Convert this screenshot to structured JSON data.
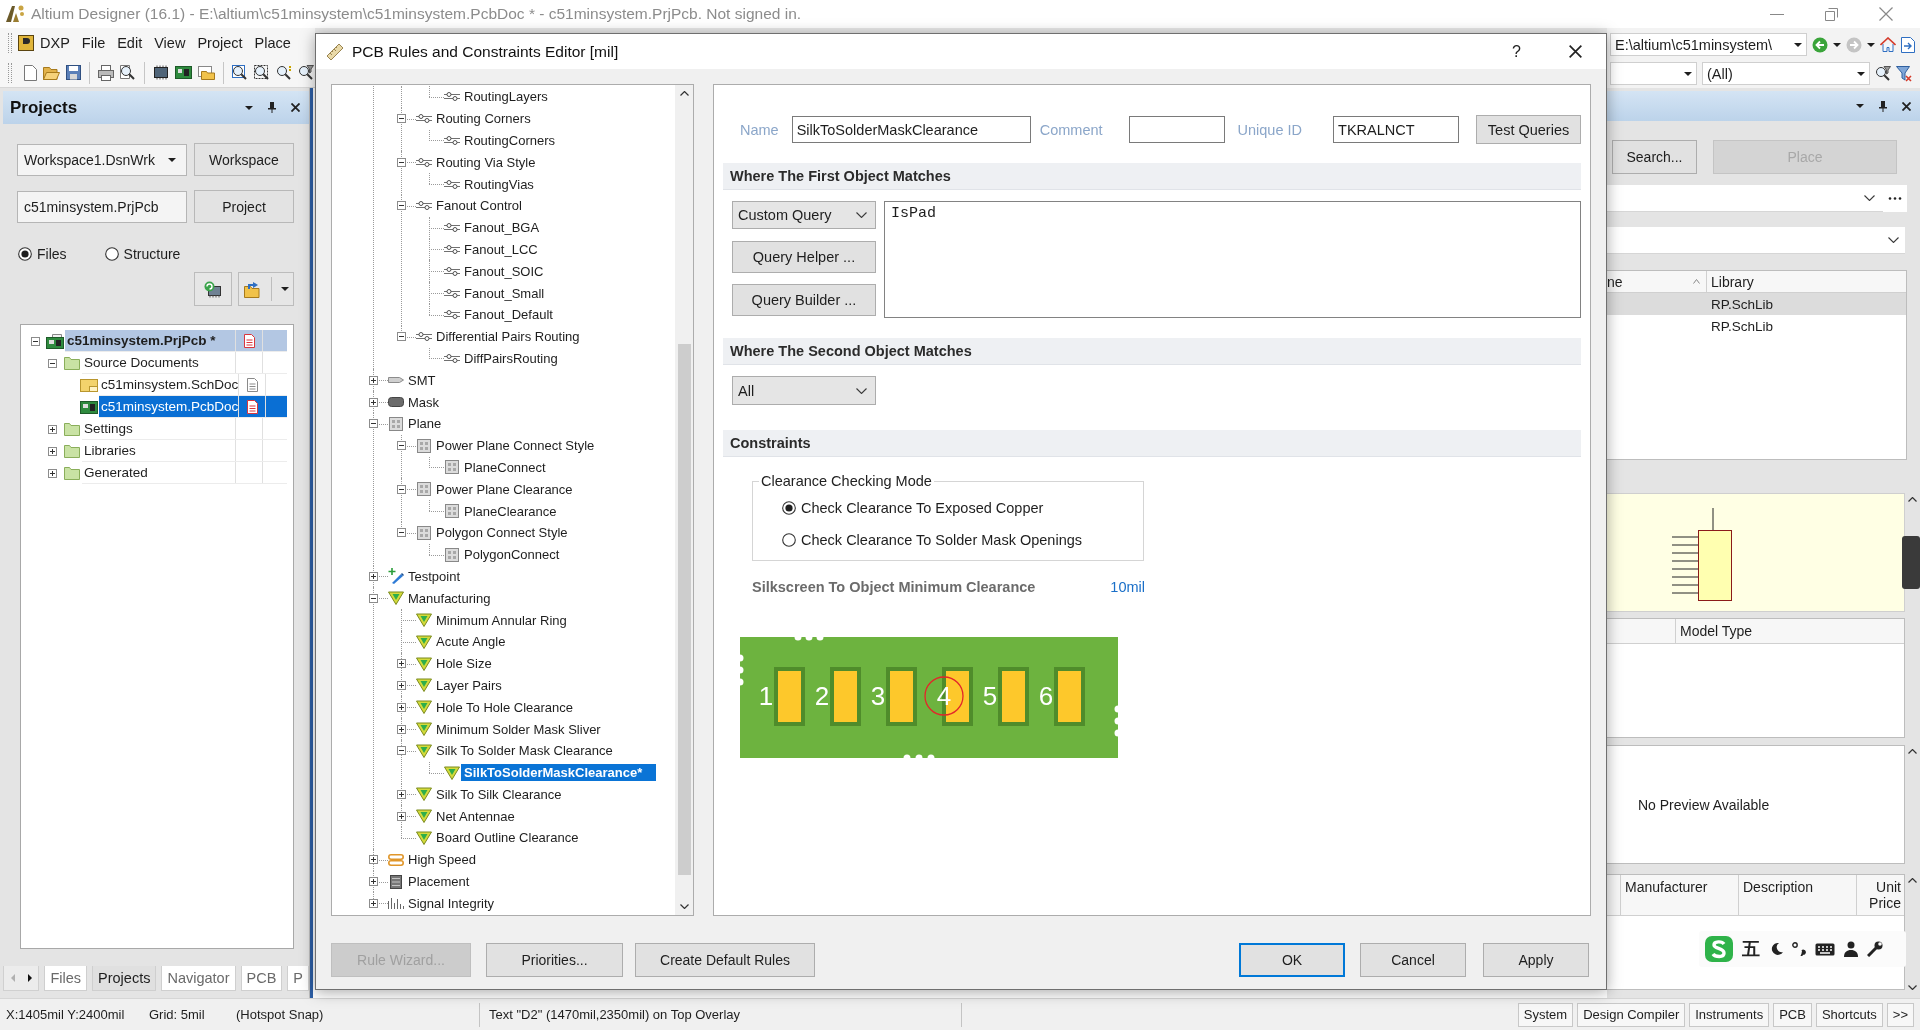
{
  "window": {
    "title": "Altium Designer (16.1) - E:\\altium\\c51minsystem\\c51minsystem.PcbDoc * - c51minsystem.PrjPcb. Not signed in."
  },
  "menu": [
    "DXP",
    "File",
    "Edit",
    "View",
    "Project",
    "Place"
  ],
  "navigation": {
    "path": "E:\\altium\\c51minsystem\\",
    "filter": "(All)"
  },
  "projects_panel": {
    "title": "Projects",
    "workspace": "Workspace1.DsnWrk",
    "workspace_button": "Workspace",
    "project": "c51minsystem.PrjPcb",
    "project_button": "Project",
    "view_options": [
      {
        "label": "Files",
        "selected": true
      },
      {
        "label": "Structure",
        "selected": false
      }
    ],
    "tree": [
      {
        "label": "c51minsystem.PrjPcb *",
        "kind": "project",
        "expanded": true,
        "active": true,
        "selected": false,
        "modified": true,
        "children": [
          {
            "label": "Source Documents",
            "kind": "folder",
            "expanded": true,
            "active": false,
            "selected": false,
            "children": [
              {
                "label": "c51minsystem.SchDoc",
                "kind": "schematic",
                "active": false,
                "selected": false,
                "modified": false
              },
              {
                "label": "c51minsystem.PcbDoc",
                "kind": "pcb",
                "active": false,
                "selected": true,
                "modified": true
              }
            ]
          },
          {
            "label": "Settings",
            "kind": "folder",
            "expanded": false,
            "active": false,
            "selected": false
          },
          {
            "label": "Libraries",
            "kind": "folder",
            "expanded": false,
            "active": false,
            "selected": false
          },
          {
            "label": "Generated",
            "kind": "folder",
            "expanded": false,
            "active": false,
            "selected": false
          }
        ]
      }
    ],
    "tabs": [
      {
        "label": "Files",
        "selected": false
      },
      {
        "label": "Projects",
        "selected": true
      },
      {
        "label": "Navigator",
        "selected": false
      },
      {
        "label": "PCB",
        "selected": false
      },
      {
        "label": "P",
        "selected": false
      }
    ]
  },
  "dialog": {
    "title": "PCB Rules and Constraints Editor [mil]",
    "help": "?",
    "rule_tree": [
      {
        "children": [
          {
            "children": [
              {
                "label": "RoutingLayers",
                "kind": "routing",
                "selected": false
              }
            ]
          },
          {
            "label": "Routing Corners",
            "kind": "routing",
            "expanded": true,
            "selected": false,
            "children": [
              {
                "label": "RoutingCorners",
                "kind": "routing",
                "selected": false
              }
            ]
          },
          {
            "label": "Routing Via Style",
            "kind": "routing",
            "expanded": true,
            "selected": false,
            "children": [
              {
                "label": "RoutingVias",
                "kind": "routing",
                "selected": false
              }
            ]
          },
          {
            "label": "Fanout Control",
            "kind": "routing",
            "expanded": true,
            "selected": false,
            "children": [
              {
                "label": "Fanout_BGA",
                "kind": "routing",
                "selected": false
              },
              {
                "label": "Fanout_LCC",
                "kind": "routing",
                "selected": false
              },
              {
                "label": "Fanout_SOIC",
                "kind": "routing",
                "selected": false
              },
              {
                "label": "Fanout_Small",
                "kind": "routing",
                "selected": false
              },
              {
                "label": "Fanout_Default",
                "kind": "routing",
                "selected": false
              }
            ]
          },
          {
            "label": "Differential Pairs Routing",
            "kind": "routing",
            "expanded": true,
            "selected": false,
            "children": [
              {
                "label": "DiffPairsRouting",
                "kind": "routing",
                "selected": false
              }
            ]
          }
        ]
      },
      {
        "label": "SMT",
        "kind": "smt",
        "expanded": false,
        "selected": false
      },
      {
        "label": "Mask",
        "kind": "mask",
        "expanded": false,
        "selected": false
      },
      {
        "label": "Plane",
        "kind": "plane",
        "expanded": true,
        "selected": false,
        "children": [
          {
            "label": "Power Plane Connect Style",
            "kind": "plane",
            "expanded": true,
            "selected": false,
            "children": [
              {
                "label": "PlaneConnect",
                "kind": "plane",
                "selected": false
              }
            ]
          },
          {
            "label": "Power Plane Clearance",
            "kind": "plane",
            "expanded": true,
            "selected": false,
            "children": [
              {
                "label": "PlaneClearance",
                "kind": "plane",
                "selected": false
              }
            ]
          },
          {
            "label": "Polygon Connect Style",
            "kind": "plane",
            "expanded": true,
            "selected": false,
            "children": [
              {
                "label": "PolygonConnect",
                "kind": "plane",
                "selected": false
              }
            ]
          }
        ]
      },
      {
        "label": "Testpoint",
        "kind": "testpoint",
        "expanded": false,
        "selected": false
      },
      {
        "label": "Manufacturing",
        "kind": "manufacturing",
        "expanded": true,
        "selected": false,
        "children": [
          {
            "label": "Minimum Annular Ring",
            "kind": "manufacturing",
            "selected": false
          },
          {
            "label": "Acute Angle",
            "kind": "manufacturing",
            "selected": false
          },
          {
            "label": "Hole Size",
            "kind": "manufacturing",
            "expanded": false,
            "selected": false
          },
          {
            "label": "Layer Pairs",
            "kind": "manufacturing",
            "expanded": false,
            "selected": false
          },
          {
            "label": "Hole To Hole Clearance",
            "kind": "manufacturing",
            "expanded": false,
            "selected": false
          },
          {
            "label": "Minimum Solder Mask Sliver",
            "kind": "manufacturing",
            "expanded": false,
            "selected": false
          },
          {
            "label": "Silk To Solder Mask Clearance",
            "kind": "manufacturing",
            "expanded": true,
            "selected": false,
            "children": [
              {
                "label": "SilkToSolderMaskClearance*",
                "kind": "manufacturing",
                "selected": true
              }
            ]
          },
          {
            "label": "Silk To Silk Clearance",
            "kind": "manufacturing",
            "expanded": false,
            "selected": false
          },
          {
            "label": "Net Antennae",
            "kind": "manufacturing",
            "expanded": false,
            "selected": false
          },
          {
            "label": "Board Outline Clearance",
            "kind": "manufacturing",
            "selected": false
          }
        ]
      },
      {
        "label": "High Speed",
        "kind": "high-speed",
        "expanded": false,
        "selected": false
      },
      {
        "label": "Placement",
        "kind": "placement",
        "expanded": false,
        "selected": false
      },
      {
        "label": "Signal Integrity",
        "kind": "signal-integrity",
        "expanded": false,
        "selected": false
      }
    ],
    "rule": {
      "name_label": "Name",
      "name": "SilkToSolderMaskClearance",
      "comment_label": "Comment",
      "unique_id_label": "Unique ID",
      "unique_id": "TKRALNCT",
      "test_button": "Test Queries"
    },
    "first_match": {
      "title": "Where The First Object Matches",
      "scope": "Custom Query",
      "query": "IsPad",
      "buttons": [
        "Query Helper ...",
        "Query Builder ..."
      ]
    },
    "second_match": {
      "title": "Where The Second Object Matches",
      "scope": "All"
    },
    "constraints": {
      "title": "Constraints",
      "mode_group": "Clearance Checking Mode",
      "modes": [
        {
          "label": "Check Clearance To Exposed Copper",
          "selected": true
        },
        {
          "label": "Check Clearance To Solder Mask Openings",
          "selected": false
        }
      ],
      "min_clearance_label": "Silkscreen To Object Minimum Clearance",
      "min_clearance": "10mil",
      "pads": [
        {
          "label": "1",
          "highlighted": false
        },
        {
          "label": "2",
          "highlighted": false
        },
        {
          "label": "3",
          "highlighted": false
        },
        {
          "label": "4",
          "highlighted": true
        },
        {
          "label": "5",
          "highlighted": false
        },
        {
          "label": "6",
          "highlighted": false
        }
      ]
    },
    "left_buttons": [
      {
        "label": "Rule Wizard...",
        "disabled": true
      },
      {
        "label": "Priorities...",
        "disabled": false
      },
      {
        "label": "Create Default Rules",
        "disabled": false
      }
    ],
    "right_buttons": [
      {
        "label": "OK",
        "default": true
      },
      {
        "label": "Cancel",
        "default": false
      },
      {
        "label": "Apply",
        "default": false
      }
    ]
  },
  "libraries_panel": {
    "search_button": "Search...",
    "place_button": {
      "label": "Place",
      "disabled": true
    },
    "columns": [
      "ne",
      "Library"
    ],
    "rows": [
      {
        "library": "RP.SchLib",
        "selected": true
      },
      {
        "library": "RP.SchLib",
        "selected": false
      }
    ],
    "model_columns": [
      "Model Type"
    ],
    "preview_message": "No Preview Available",
    "supplier_columns": [
      "Manufacturer",
      "Description",
      "Unit Price"
    ]
  },
  "ime_toolbar": {
    "mode": "五"
  },
  "status_bar": {
    "items": [
      "X:1405mil Y:2400mil",
      "Grid: 5mil",
      "(Hotspot Snap)",
      "Text \"D2\" (1470mil,2350mil) on Top Overlay"
    ],
    "panels": [
      "System",
      "Design Compiler",
      "Instruments",
      "PCB",
      "Shortcuts",
      ">>"
    ]
  }
}
